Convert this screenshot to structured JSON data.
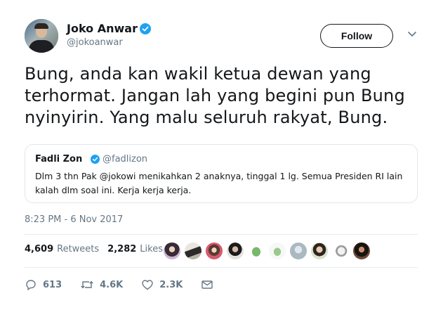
{
  "author": {
    "name": "Joko Anwar",
    "handle": "@jokoanwar",
    "verified": true
  },
  "follow_label": "Follow",
  "tweet": {
    "text": "Bung, anda kan wakil ketua dewan yang\nterhormat. Jangan lah yang begini pun Bung\nnyinyirin. Yang malu seluruh rakyat, Bung."
  },
  "quoted": {
    "name": "Fadli Zon",
    "handle": "@fadlizon",
    "verified": true,
    "text": "Dlm 3 thn Pak @jokowi menikahkan 2 anaknya, tinggal 1 lg. Semua Presiden RI lain kalah dlm soal ini. Kerja kerja kerja."
  },
  "timestamp": "8:23 PM - 6 Nov 2017",
  "stats": {
    "retweets_count": "4,609",
    "retweets_label": "Retweets",
    "likes_count": "2,282",
    "likes_label": "Likes"
  },
  "liker_avatars": [
    "avatar-1",
    "avatar-2",
    "avatar-3",
    "avatar-4",
    "avatar-5",
    "avatar-6",
    "avatar-7",
    "avatar-8",
    "avatar-9",
    "avatar-10"
  ],
  "actions": {
    "reply_count": "613",
    "retweet_count": "4.6K",
    "like_count": "2.3K"
  },
  "colors": {
    "text": "#14171a",
    "secondary": "#657786",
    "verified": "#1da1f2",
    "border": "#e1e8ed"
  }
}
